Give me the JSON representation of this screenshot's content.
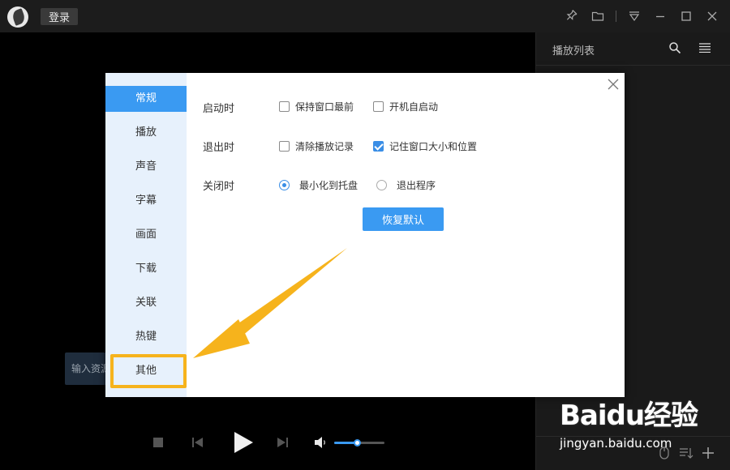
{
  "topbar": {
    "login_label": "登录"
  },
  "player": {
    "hint_text": "输入资源"
  },
  "playlist": {
    "title": "播放列表"
  },
  "dialog": {
    "nav": [
      {
        "label": "常规",
        "active": true
      },
      {
        "label": "播放"
      },
      {
        "label": "声音"
      },
      {
        "label": "字幕"
      },
      {
        "label": "画面"
      },
      {
        "label": "下载"
      },
      {
        "label": "关联"
      },
      {
        "label": "热键"
      },
      {
        "label": "其他"
      }
    ],
    "startup": {
      "label": "启动时",
      "keep_on_top": "保持窗口最前",
      "keep_on_top_checked": false,
      "autostart": "开机自启动",
      "autostart_checked": false
    },
    "exit": {
      "label": "退出时",
      "clear_history": "清除播放记录",
      "clear_history_checked": false,
      "remember_window": "记住窗口大小和位置",
      "remember_window_checked": true
    },
    "close": {
      "label": "关闭时",
      "minimize_tray": "最小化到托盘",
      "minimize_tray_selected": true,
      "exit_program": "退出程序",
      "exit_program_selected": false
    },
    "reset_label": "恢复默认"
  },
  "volume": {
    "level": 0.45
  },
  "colors": {
    "accent": "#3a9af2",
    "highlight": "#f6b31c",
    "sidebar_bg": "#e7f1fc"
  },
  "watermark": {
    "logo": "Baidu经验",
    "url": "jingyan.baidu.com"
  }
}
